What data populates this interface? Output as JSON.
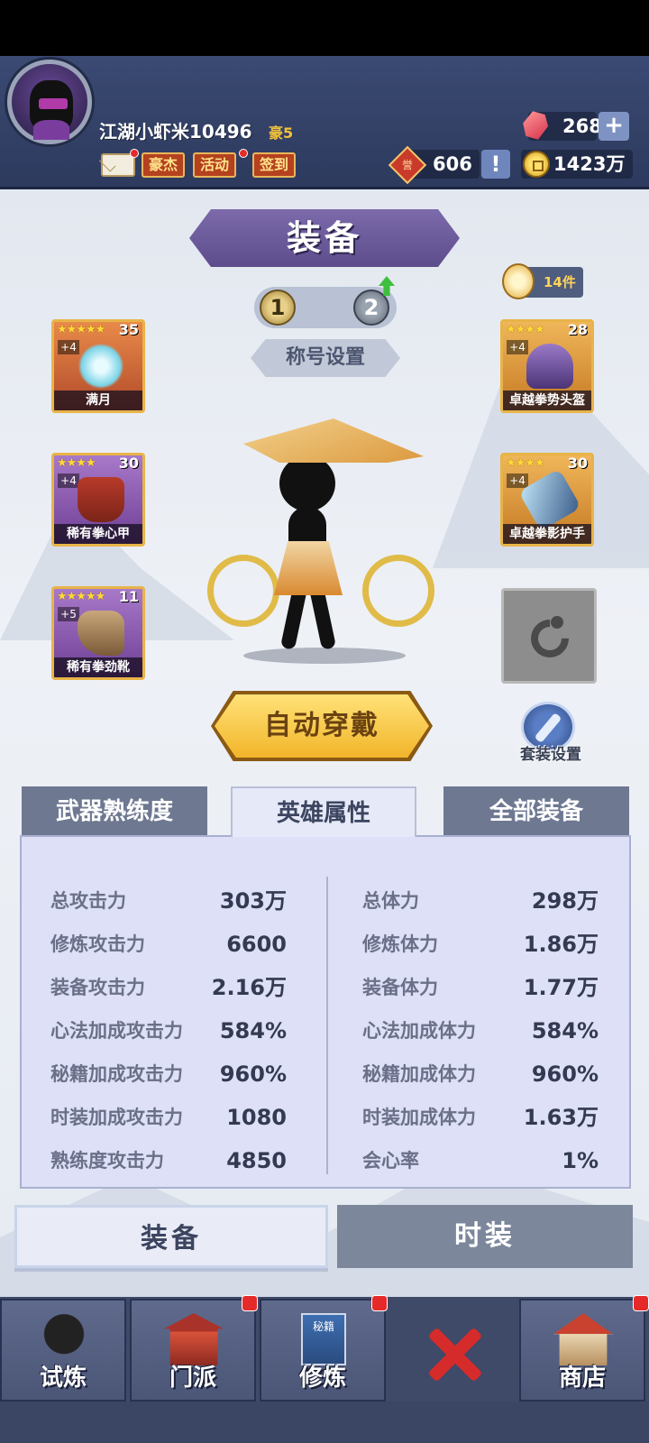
{
  "header": {
    "player_name": "江湖小虾米10496",
    "rank_tag": "豪5",
    "buttons": [
      "豪杰",
      "活动",
      "签到"
    ],
    "gems": "268",
    "honor": "606",
    "coins": "1423万",
    "plus_symbol": "+",
    "excl_symbol": "!",
    "honor_glyph": "誉"
  },
  "equip_screen": {
    "title": "装备",
    "set_count": "14件",
    "loadout_slots": [
      "1",
      "2"
    ],
    "title_setting": "称号设置",
    "auto_equip": "自动穿戴",
    "suit_setting": "套装设置"
  },
  "slots": [
    {
      "name": "满月",
      "stars": "★★★★★",
      "level": "35",
      "plus": "+4",
      "color": "#e88a4a"
    },
    {
      "name": "稀有拳心甲",
      "stars": "★★★★",
      "level": "30",
      "plus": "+4",
      "color": "#a879c9"
    },
    {
      "name": "稀有拳劲靴",
      "stars": "★★★★★",
      "level": "11",
      "plus": "+5",
      "color": "#a879c9"
    },
    {
      "name": "卓越拳势头盔",
      "stars": "★★★★",
      "level": "28",
      "plus": "+4",
      "color": "#f0b65a"
    },
    {
      "name": "卓越拳影护手",
      "stars": "★★★★",
      "level": "30",
      "plus": "+4",
      "color": "#f0b65a"
    }
  ],
  "tabs": [
    "武器熟练度",
    "英雄属性",
    "全部装备"
  ],
  "stats_left": [
    {
      "label": "总攻击力",
      "value": "303万"
    },
    {
      "label": "修炼攻击力",
      "value": "6600"
    },
    {
      "label": "装备攻击力",
      "value": "2.16万"
    },
    {
      "label": "心法加成攻击力",
      "value": "584%"
    },
    {
      "label": "秘籍加成攻击力",
      "value": "960%"
    },
    {
      "label": "时装加成攻击力",
      "value": "1080"
    },
    {
      "label": "熟练度攻击力",
      "value": "4850"
    }
  ],
  "stats_right": [
    {
      "label": "总体力",
      "value": "298万"
    },
    {
      "label": "修炼体力",
      "value": "1.86万"
    },
    {
      "label": "装备体力",
      "value": "1.77万"
    },
    {
      "label": "心法加成体力",
      "value": "584%"
    },
    {
      "label": "秘籍加成体力",
      "value": "960%"
    },
    {
      "label": "时装加成体力",
      "value": "1.63万"
    },
    {
      "label": "会心率",
      "value": "1%"
    }
  ],
  "bottom_tabs": [
    "装备",
    "时装"
  ],
  "nav": [
    "试炼",
    "门派",
    "修炼",
    "商店"
  ],
  "book_glyph": "秘籍"
}
